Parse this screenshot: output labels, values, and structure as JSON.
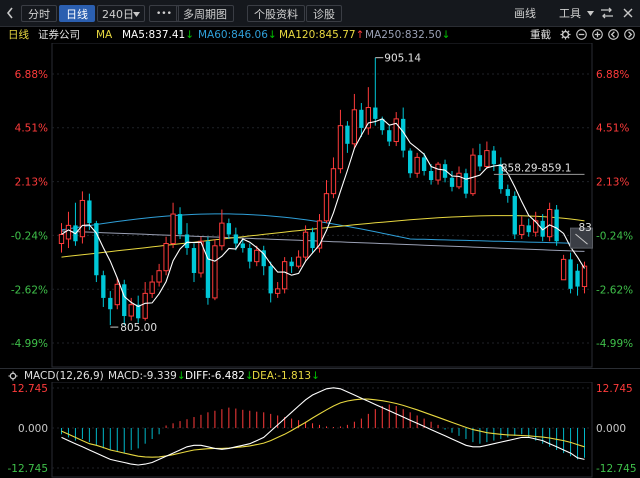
{
  "toolbar": {
    "collapse_icon": "chevron-left-icon",
    "tabs": [
      "分时",
      "日线"
    ],
    "active_tab": "日线",
    "period_select": "240日",
    "more_label": "•••",
    "multi_period": "多周期图",
    "stock_info": "个股资料",
    "diagnose": "诊股",
    "draw_line": "画线",
    "tools": "工具",
    "swap_icon": "swap-icon",
    "close_icon": "close-icon"
  },
  "info": {
    "period": "日线",
    "stock_name": "证券公司",
    "ma_label": "MA",
    "ma5": "MA5:837.41",
    "ma60": "MA60:846.06",
    "ma120": "MA120:845.77",
    "ma250": "MA250:832.50",
    "reset_label": "重截",
    "colors": {
      "ma5": "#ffffff",
      "ma60": "#2f9fd8",
      "ma120": "#e8d840",
      "ma250": "#9aa0b4"
    }
  },
  "macd_info": {
    "label": "MACD(12,26,9)",
    "macd": "MACD:-9.339",
    "diff": "DIFF:-6.482",
    "dea": "DEA:-1.813"
  },
  "chart_data": [
    {
      "type": "candlestick",
      "y_ticks": [
        "6.88%",
        "4.51%",
        "2.13%",
        "-0.24%",
        "-2.62%",
        "-4.99%"
      ],
      "annotations": {
        "high": "905.14",
        "low": "805.00",
        "price_range": "858.29-859.1",
        "cursor_value": "83"
      },
      "colors": {
        "up": "#ff3b3b",
        "down": "#00c8d8",
        "ma5": "#ffffff",
        "ma60": "#2f9fd8",
        "ma120": "#e8d840",
        "ma250": "#9aa0b4"
      },
      "candles": [
        [
          -0.6,
          -0.2,
          -1.0,
          0.3
        ],
        [
          -0.4,
          0.2,
          -0.8,
          0.8
        ],
        [
          0.2,
          -0.5,
          -0.7,
          1.2
        ],
        [
          -0.3,
          1.3,
          -0.6,
          1.7
        ],
        [
          1.3,
          0.3,
          0.0,
          1.6
        ],
        [
          0.3,
          -2.0,
          -2.3,
          0.4
        ],
        [
          -2.0,
          -3.0,
          -3.4,
          -1.8
        ],
        [
          -3.0,
          -3.5,
          -4.2,
          -2.7
        ],
        [
          -3.3,
          -2.4,
          -3.5,
          -2.1
        ],
        [
          -2.4,
          -3.8,
          -4.2,
          -2.2
        ],
        [
          -3.8,
          -3.3,
          -4.0,
          -3.0
        ],
        [
          -3.3,
          -3.9,
          -4.1,
          -2.9
        ],
        [
          -3.9,
          -2.8,
          -4.0,
          -2.3
        ],
        [
          -2.8,
          -2.3,
          -3.0,
          -2.0
        ],
        [
          -2.3,
          -1.8,
          -2.5,
          -1.5
        ],
        [
          -1.8,
          -0.6,
          -2.0,
          -0.3
        ],
        [
          -0.6,
          0.7,
          -0.8,
          1.2
        ],
        [
          0.7,
          -0.2,
          -0.4,
          1.0
        ],
        [
          -0.2,
          -0.8,
          -1.1,
          0.3
        ],
        [
          -0.8,
          -1.9,
          -2.3,
          -0.6
        ],
        [
          -1.9,
          -0.5,
          -2.1,
          -0.3
        ],
        [
          -0.5,
          -3.0,
          -3.3,
          -0.3
        ],
        [
          -3.0,
          -0.7,
          -3.1,
          -0.4
        ],
        [
          -0.7,
          0.3,
          -0.9,
          0.9
        ],
        [
          0.3,
          -0.2,
          -0.4,
          0.5
        ],
        [
          -0.2,
          -0.6,
          -0.9,
          0.1
        ],
        [
          -0.6,
          -0.8,
          -1.0,
          -0.4
        ],
        [
          -0.8,
          -1.4,
          -1.7,
          -0.6
        ],
        [
          -1.4,
          -0.9,
          -1.6,
          -0.7
        ],
        [
          -0.9,
          -1.6,
          -2.0,
          -0.7
        ],
        [
          -1.6,
          -2.8,
          -3.2,
          -1.4
        ],
        [
          -2.8,
          -2.6,
          -3.0,
          -2.3
        ],
        [
          -2.6,
          -1.4,
          -2.8,
          -1.2
        ],
        [
          -1.4,
          -1.6,
          -1.9,
          -1.2
        ],
        [
          -1.6,
          -1.2,
          -1.7,
          -0.9
        ],
        [
          -1.2,
          -0.1,
          -1.4,
          0.2
        ],
        [
          -0.1,
          -0.8,
          -1.0,
          0.1
        ],
        [
          -0.8,
          0.4,
          -1.0,
          0.7
        ],
        [
          0.4,
          1.6,
          0.3,
          2.2
        ],
        [
          1.6,
          2.7,
          1.4,
          3.2
        ],
        [
          2.7,
          4.6,
          2.5,
          5.3
        ],
        [
          4.6,
          3.8,
          3.4,
          4.8
        ],
        [
          3.8,
          5.3,
          3.6,
          6.0
        ],
        [
          5.3,
          4.5,
          4.1,
          5.6
        ],
        [
          4.5,
          5.4,
          4.2,
          6.3
        ],
        [
          5.4,
          4.9,
          4.6,
          7.6
        ],
        [
          4.9,
          4.4,
          4.2,
          5.0
        ],
        [
          4.4,
          3.9,
          3.7,
          4.6
        ],
        [
          3.9,
          4.9,
          3.7,
          5.2
        ],
        [
          4.9,
          3.5,
          3.2,
          5.4
        ],
        [
          3.5,
          2.5,
          2.3,
          3.6
        ],
        [
          2.5,
          3.2,
          2.3,
          3.4
        ],
        [
          3.2,
          2.6,
          2.4,
          3.4
        ],
        [
          2.6,
          2.2,
          2.0,
          2.9
        ],
        [
          2.2,
          2.9,
          2.0,
          3.0
        ],
        [
          2.9,
          2.3,
          2.1,
          3.1
        ],
        [
          2.3,
          1.9,
          1.7,
          2.6
        ],
        [
          1.9,
          2.5,
          1.8,
          2.8
        ],
        [
          2.5,
          1.6,
          1.4,
          2.7
        ],
        [
          1.6,
          3.3,
          1.5,
          3.6
        ],
        [
          3.3,
          2.8,
          2.6,
          3.8
        ],
        [
          2.8,
          3.5,
          2.7,
          3.9
        ],
        [
          3.5,
          2.9,
          2.6,
          3.7
        ],
        [
          2.9,
          1.8,
          1.6,
          3.2
        ],
        [
          1.8,
          1.5,
          1.2,
          2.0
        ],
        [
          1.5,
          -0.2,
          -0.4,
          1.7
        ],
        [
          -0.2,
          0.2,
          -0.4,
          0.6
        ],
        [
          0.2,
          -0.1,
          -0.3,
          0.5
        ],
        [
          -0.1,
          0.4,
          -0.3,
          0.8
        ],
        [
          0.4,
          -0.3,
          -0.5,
          0.7
        ],
        [
          -0.3,
          0.9,
          -0.5,
          1.2
        ],
        [
          0.9,
          -0.5,
          -0.7,
          1.1
        ],
        [
          -2.2,
          -1.3,
          -1.5,
          -1.1
        ],
        [
          -1.3,
          -2.6,
          -2.8,
          -1.0
        ],
        [
          -1.8,
          -2.5,
          -2.9,
          -1.5
        ],
        [
          -2.5,
          -1.6,
          -2.8,
          -1.4
        ]
      ]
    },
    {
      "type": "bar",
      "y_ticks": [
        "12.745",
        "0.000",
        "-12.745"
      ],
      "colors": {
        "pos": "#ff3b3b",
        "neg": "#00b8c8",
        "diff": "#ffffff",
        "dea": "#e8d840"
      },
      "hist": [
        -2.0,
        -3.0,
        -4.0,
        -3.5,
        -4.5,
        -5.5,
        -6.5,
        -7.0,
        -7.5,
        -8.0,
        -7.0,
        -6.5,
        -5.0,
        -3.5,
        -2.0,
        0.8,
        1.5,
        2.2,
        2.8,
        3.5,
        4.2,
        5.0,
        5.5,
        6.0,
        6.5,
        6.2,
        5.8,
        5.5,
        5.2,
        5.0,
        4.5,
        4.0,
        3.5,
        3.0,
        2.5,
        2.0,
        1.5,
        1.0,
        0.5,
        0.3,
        0.5,
        1.0,
        2.0,
        3.0,
        4.5,
        6.0,
        7.0,
        7.5,
        7.0,
        6.0,
        5.0,
        4.0,
        3.0,
        2.0,
        1.0,
        -0.5,
        -1.5,
        -2.5,
        -3.5,
        -4.5,
        -5.0,
        -4.5,
        -4.0,
        -3.5,
        -3.0,
        -2.5,
        -2.0,
        -3.0,
        -4.0,
        -5.0,
        -6.0,
        -7.0,
        -8.0,
        -9.0,
        -10.0,
        -9.5
      ],
      "diff_line": [
        -3,
        -4,
        -5,
        -6,
        -7,
        -8,
        -9,
        -10,
        -10.5,
        -11,
        -11.5,
        -11.8,
        -11.5,
        -11,
        -10,
        -9,
        -8,
        -7,
        -6,
        -5.5,
        -5.5,
        -6,
        -6.5,
        -6.8,
        -6.5,
        -6,
        -5.5,
        -5,
        -4,
        -3,
        -1,
        1,
        3,
        5,
        7,
        9,
        10.5,
        11.5,
        12.5,
        12.8,
        12.5,
        11.5,
        10.5,
        9.5,
        8.5,
        7.5,
        6.5,
        5.5,
        4.5,
        3.5,
        2.5,
        1.5,
        0.5,
        -0.5,
        -1.5,
        -2.5,
        -3.5,
        -4.5,
        -5.5,
        -6,
        -6,
        -5.5,
        -5,
        -4.5,
        -4,
        -3.5,
        -3,
        -3,
        -3.5,
        -4,
        -5,
        -6,
        -7,
        -8,
        -9.5,
        -10
      ],
      "dea_line": [
        -1,
        -2,
        -3,
        -4,
        -5,
        -5.5,
        -6.2,
        -7,
        -7.5,
        -8,
        -8.5,
        -9,
        -9.2,
        -9.3,
        -9.2,
        -8.9,
        -8.5,
        -8,
        -7.5,
        -7,
        -6.8,
        -6.6,
        -6.5,
        -6.5,
        -6.4,
        -6.2,
        -6,
        -5.7,
        -5.3,
        -4.8,
        -4,
        -3,
        -2,
        -0.8,
        0.5,
        1.8,
        3.2,
        4.5,
        5.8,
        7,
        8,
        8.6,
        9,
        9.2,
        9.2,
        9,
        8.7,
        8.3,
        7.8,
        7.2,
        6.5,
        5.8,
        5,
        4.2,
        3.4,
        2.6,
        1.8,
        1,
        0.2,
        -0.5,
        -1,
        -1.5,
        -1.8,
        -2,
        -2.2,
        -2.3,
        -2.4,
        -2.5,
        -2.7,
        -2.9,
        -3.2,
        -3.6,
        -4,
        -4.6,
        -5.3,
        -6
      ]
    }
  ]
}
